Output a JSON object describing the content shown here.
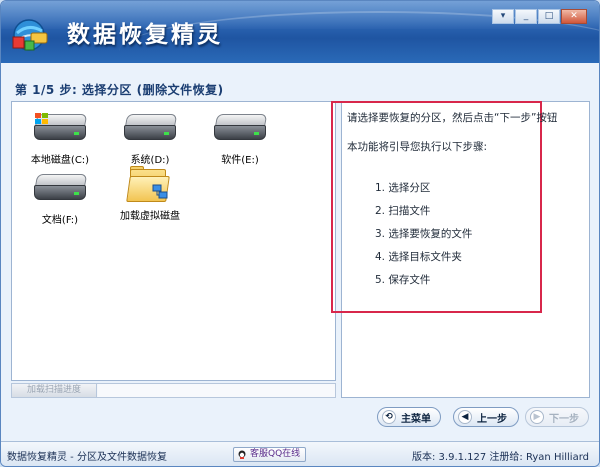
{
  "app": {
    "title": "数据恢复精灵"
  },
  "window_controls": {
    "menu": "▾",
    "minimize": "_",
    "maximize": "□",
    "close": "✕"
  },
  "step_header": "第 1/5 步: 选择分区 (删除文件恢复)",
  "drives": [
    {
      "label": "本地磁盘(C:)",
      "icon": "system-hdd-icon"
    },
    {
      "label": "系统(D:)",
      "icon": "hdd-icon"
    },
    {
      "label": "软件(E:)",
      "icon": "hdd-icon"
    },
    {
      "label": "文档(F:)",
      "icon": "hdd-icon"
    },
    {
      "label": "加载虚拟磁盘",
      "icon": "virtual-disk-folder-icon"
    }
  ],
  "progress": {
    "label": "加载扫描进度",
    "value": 0
  },
  "info": {
    "intro": "请选择要恢复的分区，然后点击“下一步”按钮",
    "lead": "本功能将引导您执行以下步骤:",
    "steps": [
      "1. 选择分区",
      "2. 扫描文件",
      "3. 选择要恢复的文件",
      "4. 选择目标文件夹",
      "5. 保存文件"
    ]
  },
  "buttons": {
    "home": "主菜单",
    "prev": "上一步",
    "next": "下一步"
  },
  "status_bar": {
    "left": "数据恢复精灵 - 分区及文件数据恢复",
    "qq": "客服QQ在线",
    "right": "版本: 3.9.1.127 注册给: Ryan Hilliard"
  },
  "colors": {
    "banner": "#2d67b5",
    "highlight_frame": "#d8274b",
    "progress_fill": "#67b34a"
  }
}
